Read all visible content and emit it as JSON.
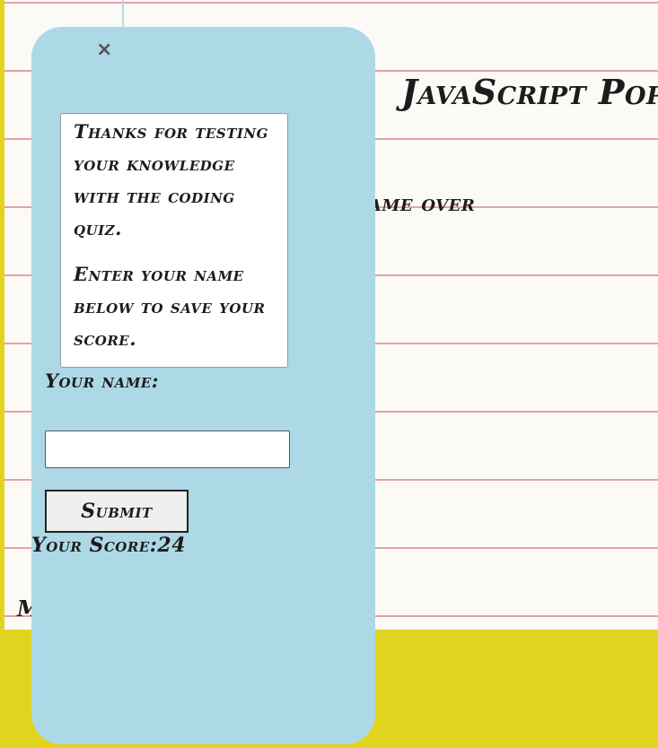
{
  "page": {
    "title_fragment": "JavaScript Pop",
    "game_over_fragment": "ame over",
    "bottom_fragment": "M"
  },
  "modal": {
    "close_symbol": "×",
    "message_line1": "Thanks for testing your knowledge with the coding quiz.",
    "message_line2": "Enter your name below to save your score.",
    "name_label": "Your name:",
    "name_value": "",
    "submit_label": "Submit",
    "score_label": "Your Score:",
    "score_value": "24"
  },
  "colors": {
    "frame": "#e1d421",
    "paper": "#fcfaf6",
    "ruled_line": "#e3a2a6",
    "modal": "#add8e6"
  }
}
